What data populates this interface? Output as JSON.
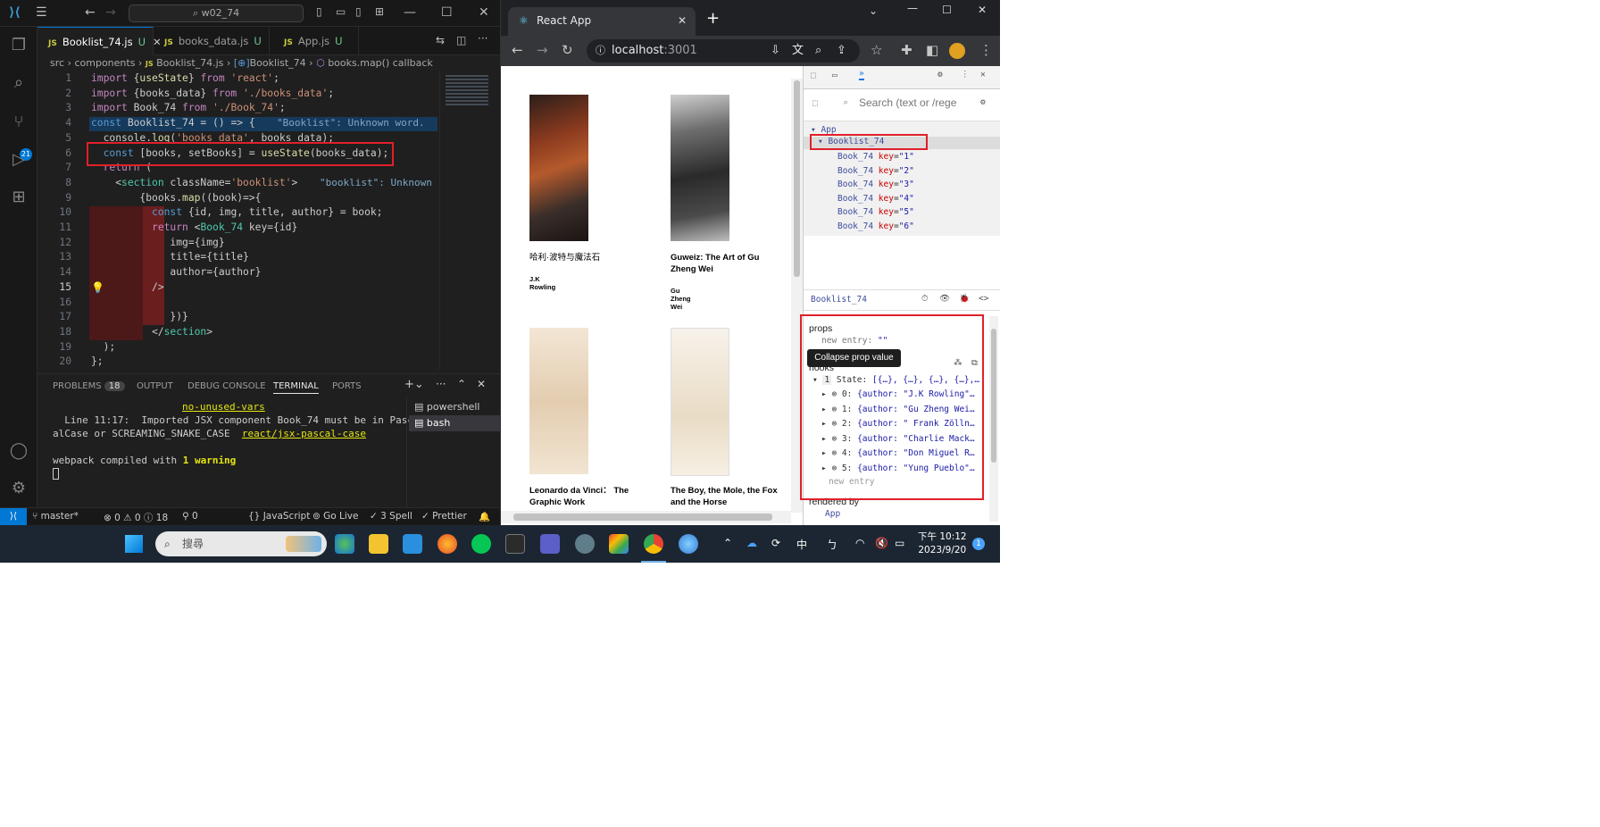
{
  "vscode": {
    "search": "w02_74",
    "tabs": [
      {
        "label": "Booklist_74.js",
        "status": "U",
        "active": true
      },
      {
        "label": "books_data.js",
        "status": "U"
      },
      {
        "label": "App.js",
        "status": "U"
      }
    ],
    "breadcrumb": [
      "src",
      "components",
      "Booklist_74.js",
      "Booklist_74",
      "books.map() callback"
    ],
    "source_control_badge": "21",
    "code_lines": [
      "import {useState} from 'react';",
      "import {books_data} from './books_data';",
      "import Book_74 from './Book_74';",
      "const Booklist_74 = () => {",
      "  console.log('books_data', books_data);",
      "  const [books, setBooks] = useState(books_data);",
      "  return (",
      "    <section className='booklist'>",
      "        {books.map((book)=>{",
      "          const {id, img, title, author} = book;",
      "          return <Book_74 key={id}",
      "             img={img}",
      "             title={title}",
      "             author={author}",
      "          />",
      "",
      "             })}",
      "          </section>",
      "  );",
      "};"
    ],
    "inline_hint_line4": "\"Booklist\": Unknown word.",
    "inline_hint_line8": "\"booklist\": Unknown",
    "current_line": "15",
    "panel_tabs": [
      "PROBLEMS",
      "OUTPUT",
      "DEBUG CONSOLE",
      "TERMINAL",
      "PORTS"
    ],
    "problems_count": "18",
    "terminal": {
      "rule_top": "no-unused-vars",
      "line1": "  Line 11:17:  Imported JSX component Book_74 must be in Pasc",
      "line2_a": "alCase or SCREAMING_SNAKE_CASE  ",
      "line2_rule": "react/jsx-pascal-case",
      "compiled_a": "webpack compiled with ",
      "compiled_b": "1 warning"
    },
    "terminals": [
      "powershell",
      "bash"
    ],
    "status": {
      "branch": "master*",
      "problems": "⊗ 0 ⚠ 0 ⓘ 18",
      "ports": "0",
      "language": "JavaScript",
      "golive": "Go Live",
      "spell": "3 Spell",
      "prettier": "Prettier"
    }
  },
  "chrome": {
    "tab_title": "React App",
    "url_host": "localhost",
    "url_port": ":3001",
    "books": [
      {
        "title": "哈利·波特与魔法石",
        "author": "J.K Rowling"
      },
      {
        "title": "Guweiz: The Art of Gu Zheng Wei",
        "author": "Gu Zheng Wei"
      },
      {
        "title": "Leonardo da Vinci： The Graphic Work",
        "author": ""
      },
      {
        "title": "The Boy, the Mole, the Fox and the Horse",
        "author": ""
      }
    ],
    "devtools": {
      "search_placeholder": "Search (text or /rege",
      "tree": {
        "root": "App",
        "selected": "Booklist_74",
        "children": [
          {
            "name": "Book_74",
            "key": "\"1\""
          },
          {
            "name": "Book_74",
            "key": "\"2\""
          },
          {
            "name": "Book_74",
            "key": "\"3\""
          },
          {
            "name": "Book_74",
            "key": "\"4\""
          },
          {
            "name": "Book_74",
            "key": "\"5\""
          },
          {
            "name": "Book_74",
            "key": "\"6\""
          }
        ]
      },
      "selected_component": "Booklist_74",
      "props_label": "props",
      "new_entry_label": "new entry",
      "new_entry_value": "\"\"",
      "hooks_label": "hooks",
      "tooltip": "Collapse prop value",
      "state_index": "1",
      "state_label": "State:",
      "state_value": "[{…}, {…}, {…}, {…},…",
      "state_items": [
        {
          "index": "0:",
          "value": "{author: \"J.K Rowling\"…"
        },
        {
          "index": "1:",
          "value": "{author: \"Gu Zheng Wei…"
        },
        {
          "index": "2:",
          "value": "{author: \" Frank Zölln…"
        },
        {
          "index": "3:",
          "value": "{author: \"Charlie Mack…"
        },
        {
          "index": "4:",
          "value": "{author: \"Don Miguel R…"
        },
        {
          "index": "5:",
          "value": "{author: \"Yung Pueblo\"…"
        }
      ],
      "rendered_by_label": "rendered by",
      "rendered_by_value": "App"
    }
  },
  "taskbar": {
    "search_placeholder": "搜尋",
    "ime": "中",
    "time": "下午 10:12",
    "date": "2023/9/20",
    "notifications": "1"
  }
}
